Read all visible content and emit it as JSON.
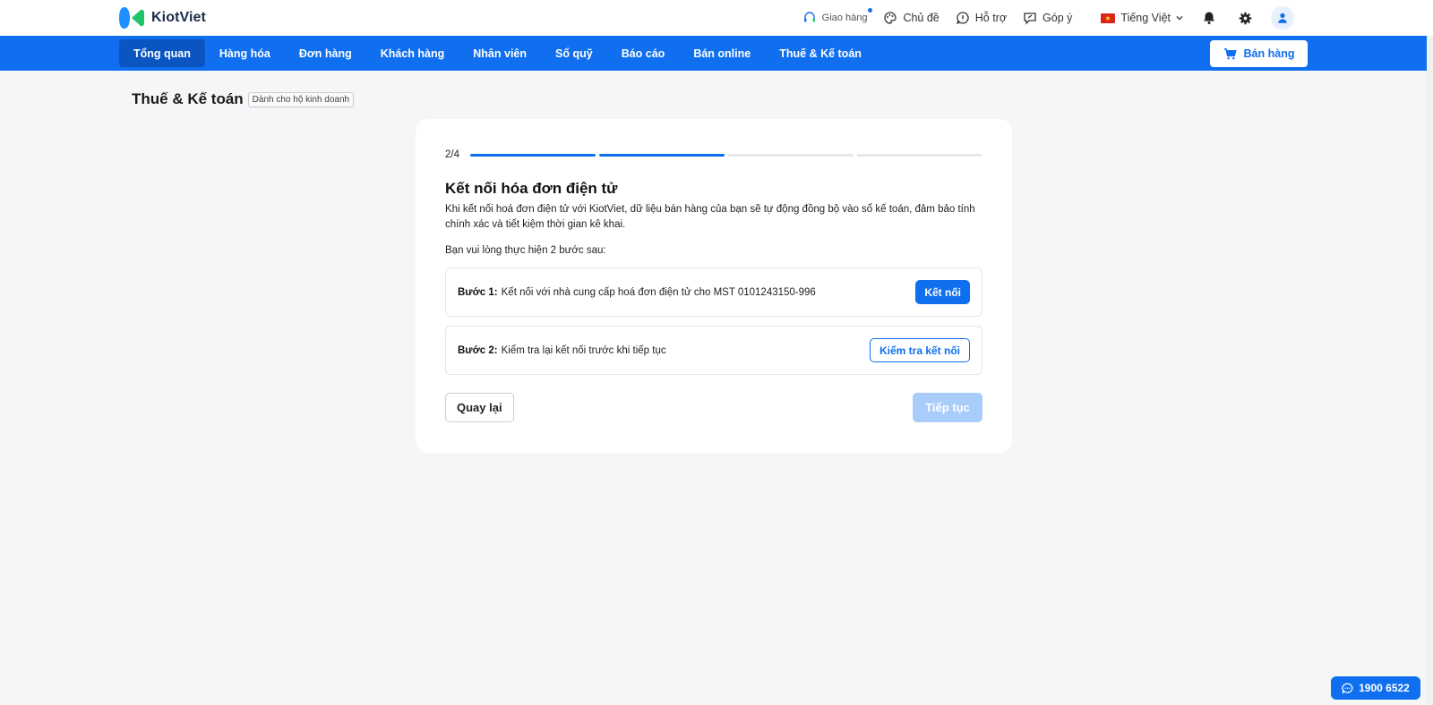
{
  "brand": {
    "name": "KiotViet"
  },
  "topbar": {
    "delivery_label": "Giao hàng",
    "theme_label": "Chủ đề",
    "support_label": "Hỗ trợ",
    "feedback_label": "Góp ý",
    "language_label": "Tiếng Việt"
  },
  "nav": {
    "items": [
      {
        "label": "Tổng quan"
      },
      {
        "label": "Hàng hóa"
      },
      {
        "label": "Đơn hàng"
      },
      {
        "label": "Khách hàng"
      },
      {
        "label": "Nhân viên"
      },
      {
        "label": "Sổ quỹ"
      },
      {
        "label": "Báo cáo"
      },
      {
        "label": "Bán online"
      },
      {
        "label": "Thuế & Kế toán"
      }
    ],
    "active_index": 0,
    "sell_label": "Bán hàng"
  },
  "page": {
    "title": "Thuế & Kế toán",
    "tag": "Dành cho hộ kinh doanh"
  },
  "wizard": {
    "progress_label": "2/4",
    "current_step": 2,
    "total_steps": 4,
    "title": "Kết nối hóa đơn điện tử",
    "description": "Khi kết nối hoá đơn điện tử với KiotViet, dữ liệu bán hàng của bạn sẽ tự động đồng bộ vào sổ kế toán, đảm bảo tính chính xác và tiết kiệm thời gian kê khai.",
    "intro": "Bạn vui lòng thực hiện 2 bước sau:",
    "step1": {
      "label": "Bước 1:",
      "text": "Kết nối với nhà cung cấp hoá đơn điện tử cho MST 0101243150-996",
      "button": "Kết nối"
    },
    "step2": {
      "label": "Bước 2:",
      "text": "Kiểm tra lại kết nối trước khi tiếp tục",
      "button": "Kiểm tra kết nối"
    },
    "back_label": "Quay lại",
    "next_label": "Tiếp tục"
  },
  "hotline": {
    "number": "1900 6522"
  },
  "colors": {
    "primary": "#0f6fef",
    "nav_active": "#0a55c2",
    "next_disabled": "#a9cdfb",
    "page_bg": "#f5f6f8"
  }
}
